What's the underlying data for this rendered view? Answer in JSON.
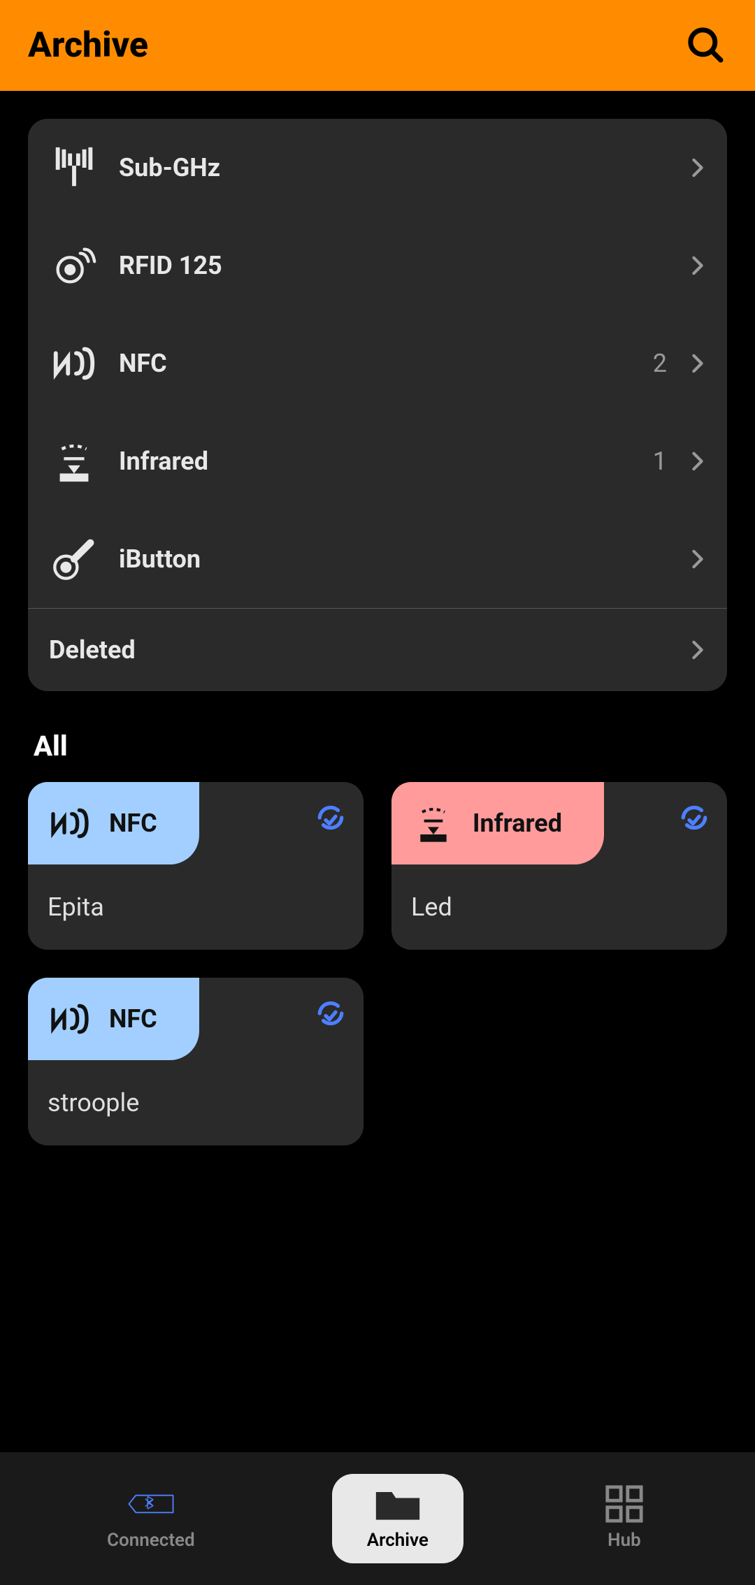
{
  "header": {
    "title": "Archive"
  },
  "folders": [
    {
      "id": "subghz",
      "label": "Sub-GHz",
      "count": ""
    },
    {
      "id": "rfid",
      "label": "RFID 125",
      "count": ""
    },
    {
      "id": "nfc",
      "label": "NFC",
      "count": "2"
    },
    {
      "id": "infrared",
      "label": "Infrared",
      "count": "1"
    },
    {
      "id": "ibutton",
      "label": "iButton",
      "count": ""
    }
  ],
  "deleted": {
    "label": "Deleted"
  },
  "section": {
    "title": "All"
  },
  "cards": [
    {
      "type": "NFC",
      "typeClass": "nfc",
      "name": "Epita"
    },
    {
      "type": "Infrared",
      "typeClass": "infrared",
      "name": "Led"
    },
    {
      "type": "NFC",
      "typeClass": "nfc",
      "name": "stroople"
    }
  ],
  "nav": {
    "connected": "Connected",
    "archive": "Archive",
    "hub": "Hub"
  }
}
